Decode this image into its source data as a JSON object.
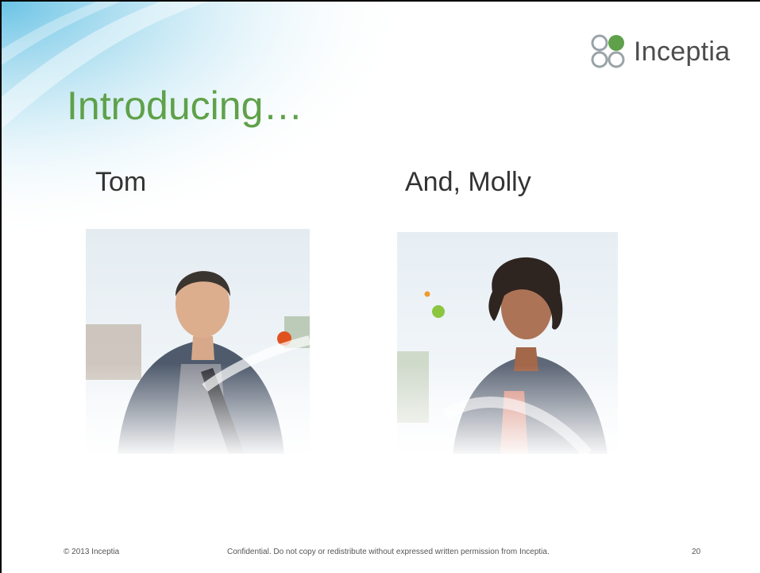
{
  "slide": {
    "title": "Introducing…",
    "brand_color": "#5fa14a",
    "logo": {
      "text": "Inceptia",
      "icon": "inceptia-logo-icon"
    }
  },
  "people": [
    {
      "name": "Tom",
      "photo": "tom-photo"
    },
    {
      "name": "And, Molly",
      "photo": "molly-photo"
    }
  ],
  "footer": {
    "copyright": "© 2013 Inceptia",
    "confidential": "Confidential. Do not copy or redistribute without expressed written permission from Inceptia.",
    "page_number": "20"
  }
}
